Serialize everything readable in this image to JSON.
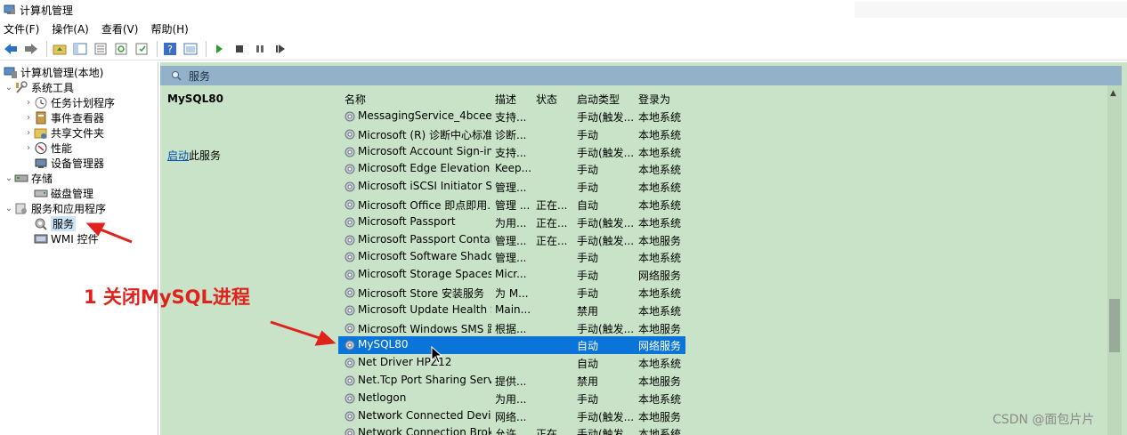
{
  "window": {
    "title": "计算机管理"
  },
  "menu": [
    "文件(F)",
    "操作(A)",
    "查看(V)",
    "帮助(H)"
  ],
  "toolbar": [
    "back",
    "forward",
    "up-folder",
    "console-tree",
    "export",
    "refresh",
    "properties",
    "help",
    "view",
    "start",
    "stop",
    "pause",
    "restart"
  ],
  "tree": {
    "root": "计算机管理(本地)",
    "system_tools": "系统工具",
    "task_scheduler": "任务计划程序",
    "event_viewer": "事件查看器",
    "shared_folders": "共享文件夹",
    "performance": "性能",
    "device_manager": "设备管理器",
    "storage": "存储",
    "disk_management": "磁盘管理",
    "services_apps": "服务和应用程序",
    "services": "服务",
    "wmi": "WMI 控件"
  },
  "panel": {
    "header": "服务",
    "selected_service": "MySQL80",
    "action_link": "启动",
    "action_suffix": "此服务"
  },
  "columns": {
    "name": "名称",
    "desc": "描述",
    "state": "状态",
    "startup": "启动类型",
    "logon": "登录为"
  },
  "services": [
    {
      "name": "MessagingService_4bceeef",
      "desc": "支持...",
      "state": "",
      "startup": "手动(触发...",
      "logon": "本地系统"
    },
    {
      "name": "Microsoft (R) 诊断中心标准...",
      "desc": "诊断...",
      "state": "",
      "startup": "手动",
      "logon": "本地系统"
    },
    {
      "name": "Microsoft Account Sign-in ...",
      "desc": "支持...",
      "state": "",
      "startup": "手动(触发...",
      "logon": "本地系统"
    },
    {
      "name": "Microsoft Edge Elevation S...",
      "desc": "Keep...",
      "state": "",
      "startup": "手动",
      "logon": "本地系统"
    },
    {
      "name": "Microsoft iSCSI Initiator Ser...",
      "desc": "管理...",
      "state": "",
      "startup": "手动",
      "logon": "本地系统"
    },
    {
      "name": "Microsoft Office 即点即用...",
      "desc": "管理 ...",
      "state": "正在...",
      "startup": "自动",
      "logon": "本地系统"
    },
    {
      "name": "Microsoft Passport",
      "desc": "为用...",
      "state": "正在...",
      "startup": "手动(触发...",
      "logon": "本地系统"
    },
    {
      "name": "Microsoft Passport Container",
      "desc": "管理...",
      "state": "正在...",
      "startup": "手动(触发...",
      "logon": "本地服务"
    },
    {
      "name": "Microsoft Software Shado...",
      "desc": "管理...",
      "state": "",
      "startup": "手动",
      "logon": "本地系统"
    },
    {
      "name": "Microsoft Storage Spaces S...",
      "desc": "Micr...",
      "state": "",
      "startup": "手动",
      "logon": "网络服务"
    },
    {
      "name": "Microsoft Store 安装服务",
      "desc": "为 M...",
      "state": "",
      "startup": "手动",
      "logon": "本地系统"
    },
    {
      "name": "Microsoft Update Health S...",
      "desc": "Main...",
      "state": "",
      "startup": "禁用",
      "logon": "本地系统"
    },
    {
      "name": "Microsoft Windows SMS 路...",
      "desc": "根据...",
      "state": "",
      "startup": "手动(触发...",
      "logon": "本地服务"
    },
    {
      "name": "MySQL80",
      "desc": "",
      "state": "",
      "startup": "自动",
      "logon": "网络服务",
      "selected": true
    },
    {
      "name": "Net Driver HPZ12",
      "desc": "",
      "state": "",
      "startup": "自动",
      "logon": "本地系统"
    },
    {
      "name": "Net.Tcp Port Sharing Service",
      "desc": "提供...",
      "state": "",
      "startup": "禁用",
      "logon": "本地服务"
    },
    {
      "name": "Netlogon",
      "desc": "为用...",
      "state": "",
      "startup": "手动",
      "logon": "本地系统"
    },
    {
      "name": "Network Connected Devic...",
      "desc": "网络...",
      "state": "",
      "startup": "手动(触发...",
      "logon": "本地服务"
    },
    {
      "name": "Network Connection Broker",
      "desc": "允许...",
      "state": "正在...",
      "startup": "手动(触发...",
      "logon": "本地系统"
    }
  ],
  "annotation": "1 关闭MySQL进程",
  "watermark": "CSDN @面包片片",
  "colors": {
    "accent": "#0a74d8",
    "panel_bg": "#c8e3c7",
    "header_bg": "#93b2ca",
    "annotation": "#e0221c"
  }
}
